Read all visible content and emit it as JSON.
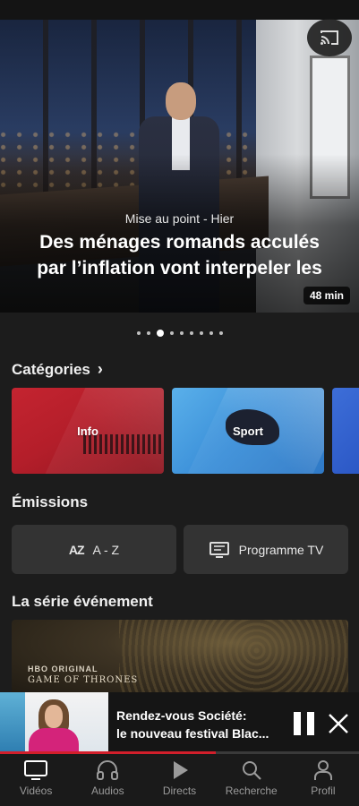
{
  "hero": {
    "subtitle": "Mise au point - Hier",
    "title_line1": "Des ménages romands acculés",
    "title_line2": "par l’inflation vont interpeler les",
    "duration": "48 min",
    "carousel_count": 9,
    "carousel_active": 2
  },
  "categories": {
    "heading": "Catégories",
    "items": [
      {
        "label": "Info"
      },
      {
        "label": "Sport"
      }
    ]
  },
  "emissions": {
    "heading": "Émissions",
    "az_icon": "AZ",
    "az_label": "A - Z",
    "tv_label": "Programme TV"
  },
  "series": {
    "heading": "La série événement",
    "hbo_text": "HBO ORIGINAL",
    "show_text": "GAME OF THRONES"
  },
  "mini_player": {
    "title_line1": "Rendez-vous Société:",
    "title_line2": "le nouveau festival Blac...",
    "progress": 0.6
  },
  "nav": {
    "items": [
      {
        "label": "Vidéos",
        "icon": "tv-icon",
        "active": true
      },
      {
        "label": "Audios",
        "icon": "headphones-icon",
        "active": false
      },
      {
        "label": "Directs",
        "icon": "play-icon",
        "active": false
      },
      {
        "label": "Recherche",
        "icon": "search-icon",
        "active": false
      },
      {
        "label": "Profil",
        "icon": "profile-icon",
        "active": false
      }
    ]
  },
  "colors": {
    "accent": "#d21f2b",
    "background": "#1c1c1c",
    "info_card": "#c42430",
    "sport_card": "#4a9fe3"
  }
}
